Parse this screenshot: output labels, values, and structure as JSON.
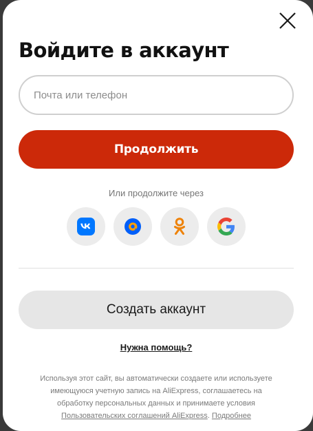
{
  "modal": {
    "title": "Войдите в аккаунт",
    "close_icon": "close-icon"
  },
  "login": {
    "placeholder": "Почта или телефон",
    "value": "",
    "continue_label": "Продолжить"
  },
  "social": {
    "caption": "Или продолжите через",
    "providers": [
      {
        "name": "vk",
        "icon": "vk-icon",
        "color": "#0077ff"
      },
      {
        "name": "mail",
        "icon": "mail-ru-icon",
        "color": "#005ff9"
      },
      {
        "name": "ok",
        "icon": "odnoklassniki-icon",
        "color": "#ee8208"
      },
      {
        "name": "google",
        "icon": "google-icon",
        "color": "#4285f4"
      }
    ]
  },
  "create_account_label": "Создать аккаунт",
  "help_label": "Нужна помощь?",
  "legal": {
    "line1": "Используя этот сайт, вы автоматически создаете или используете",
    "line2": "имеющуюся учетную запись на AliExpress, соглашаетесь на",
    "line3": "обработку персональных данных и принимаете условия",
    "link_terms": "Пользовательских соглашений AliExpress",
    "separator": ".",
    "link_more": "Подробнее"
  },
  "colors": {
    "primary": "#cc2909",
    "secondary_button": "#e6e6e6",
    "social_bg": "#ececec"
  }
}
